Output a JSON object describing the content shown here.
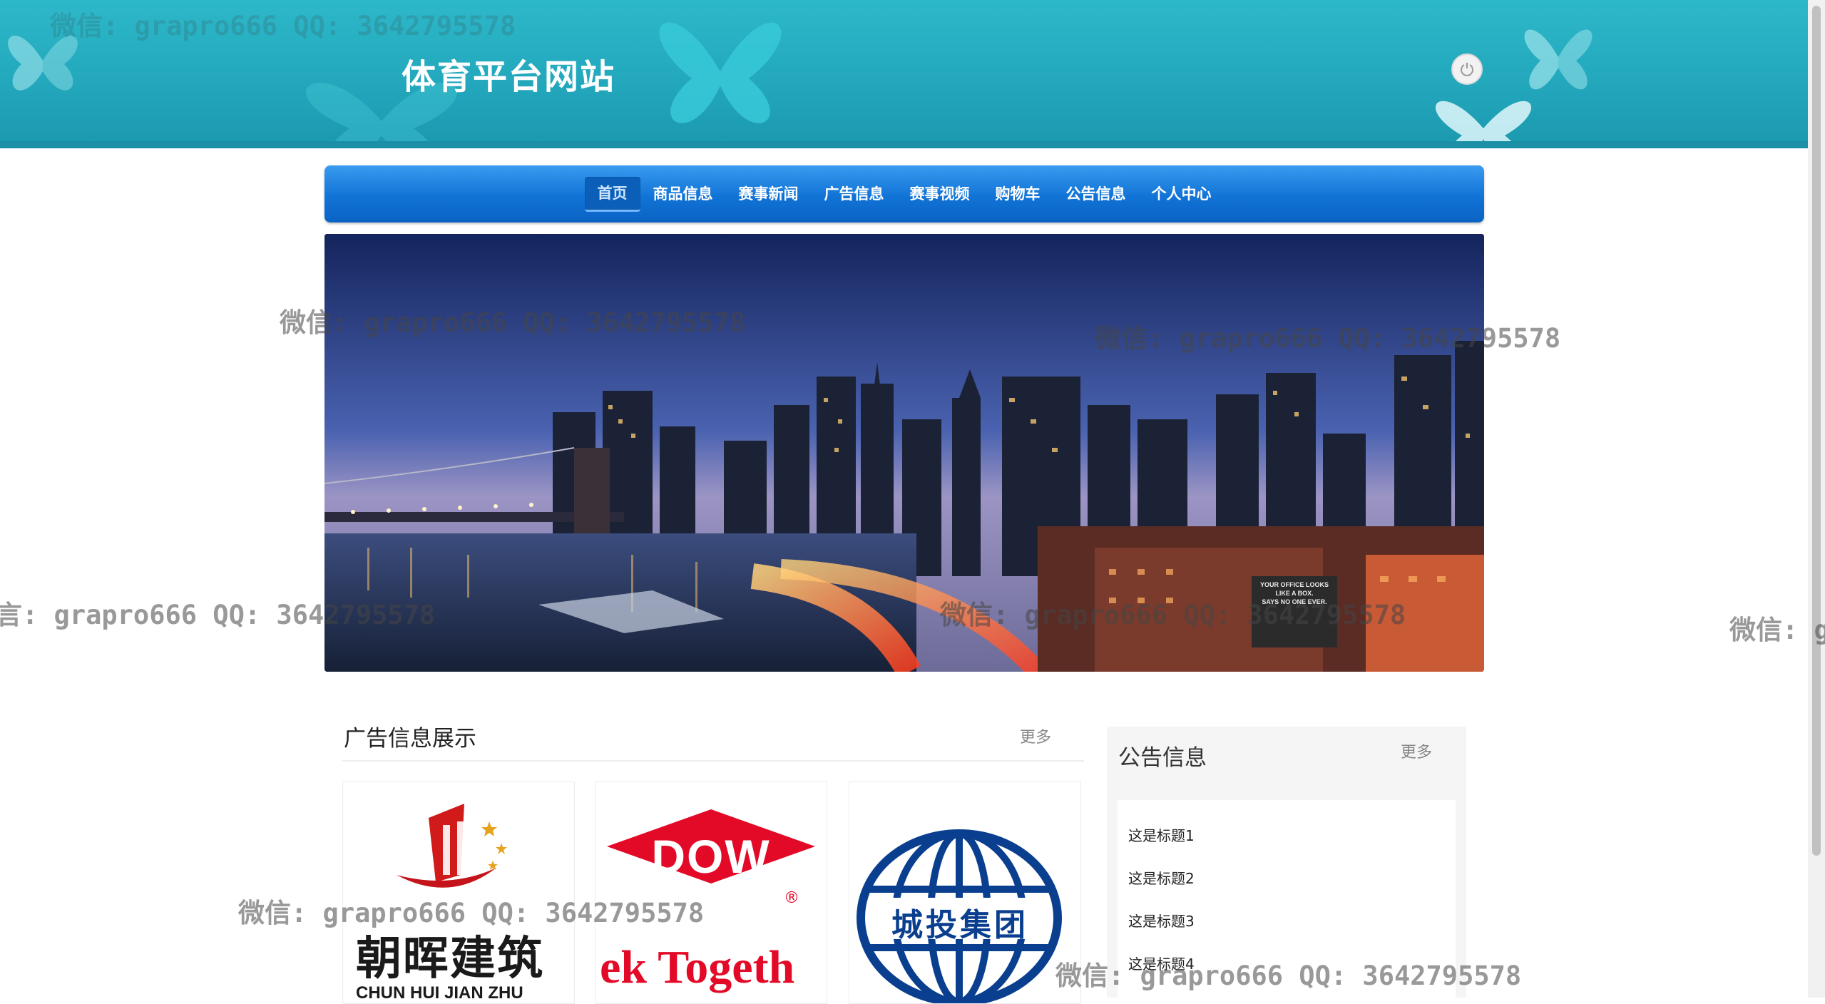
{
  "header": {
    "site_title": "体育平台网站",
    "logout_icon": "power-icon"
  },
  "nav": {
    "items": [
      {
        "label": "首页",
        "active": true
      },
      {
        "label": "商品信息",
        "active": false
      },
      {
        "label": "赛事新闻",
        "active": false
      },
      {
        "label": "广告信息",
        "active": false
      },
      {
        "label": "赛事视频",
        "active": false
      },
      {
        "label": "购物车",
        "active": false
      },
      {
        "label": "公告信息",
        "active": false
      },
      {
        "label": "个人中心",
        "active": false
      }
    ]
  },
  "hero": {
    "overlay_sign": "YOUR OFFICE LOOKS\nLIKE A BOX.\nSAYS NO ONE EVER."
  },
  "ads": {
    "title": "广告信息展示",
    "more": "更多",
    "cards": [
      {
        "logo_text": "朝晖建筑",
        "sub_text": "CHUN HUI JIAN ZHU"
      },
      {
        "logo_text": "DOW",
        "sub_text": "ek Togeth",
        "reg_mark": "®"
      },
      {
        "logo_text": "城投集团"
      }
    ]
  },
  "notice": {
    "title": "公告信息",
    "more": "更多",
    "items": [
      "这是标题1",
      "这是标题2",
      "这是标题3",
      "这是标题4"
    ]
  },
  "watermark": {
    "text": "微信: grapro666 QQ: 3642795578",
    "partial_left": "言: grapro666 QQ: 3642795578",
    "partial_right": "微信: g"
  },
  "colors": {
    "header_teal": "#22a6bb",
    "nav_blue": "#1173d6",
    "dow_red": "#e30a28",
    "chengtou_blue": "#0a3f8f"
  }
}
